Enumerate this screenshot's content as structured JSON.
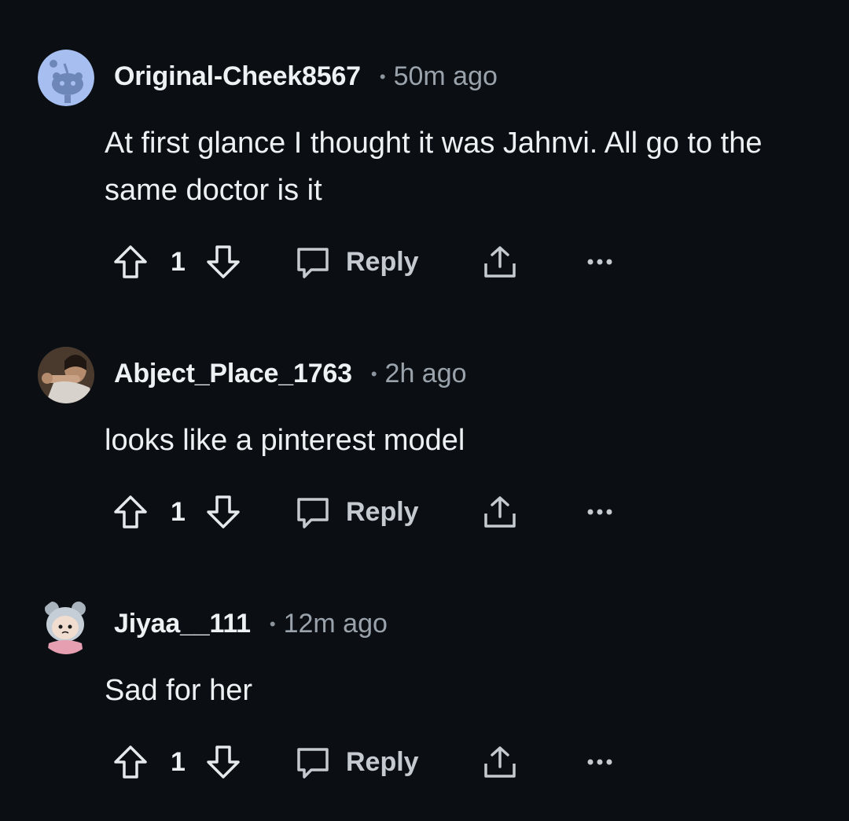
{
  "comments": [
    {
      "author": "Original-Cheek8567",
      "time": "50m ago",
      "body": "At first glance I thought it was Jahnvi. All go to the same doctor is it",
      "score": "1",
      "reply_label": "Reply",
      "avatar": "default-snoo-avatar"
    },
    {
      "author": "Abject_Place_1763",
      "time": "2h ago",
      "body": "looks like a pinterest model",
      "score": "1",
      "reply_label": "Reply",
      "avatar": "photo-avatar"
    },
    {
      "author": "Jiyaa__111",
      "time": "12m ago",
      "body": "Sad for her",
      "score": "1",
      "reply_label": "Reply",
      "avatar": "cartoon-avatar"
    }
  ],
  "separator": "•",
  "icons": {
    "upvote": "upvote-arrow-icon",
    "downvote": "downvote-arrow-icon",
    "reply": "speech-bubble-icon",
    "share": "share-icon",
    "more": "more-options-icon"
  },
  "colors": {
    "background": "#0b0f14",
    "text": "#eef1f3",
    "muted": "#9aa3ab"
  }
}
